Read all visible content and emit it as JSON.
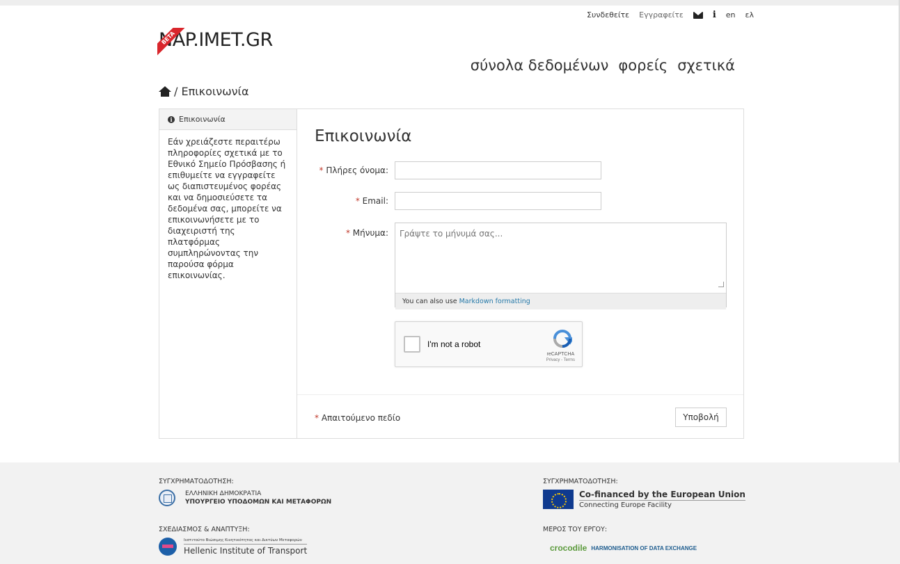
{
  "topbar": {
    "login": "Συνδεθείτε",
    "register": "Εγγραφείτε",
    "envelope_icon": "envelope-icon",
    "info_icon": "info-icon",
    "lang_en": "en",
    "lang_el": "ελ"
  },
  "header": {
    "logo_text": "NAP.IMET.GR",
    "beta": "BETA"
  },
  "nav": {
    "datasets": "σύνολα δεδομένων",
    "organizations": "φορείς",
    "about": "σχετικά"
  },
  "breadcrumb": {
    "home_icon": "home-icon",
    "current": "/ Επικοινωνία"
  },
  "sidebar": {
    "title": "Επικοινωνία",
    "text": "Εάν χρειάζεστε περαιτέρω πληροφορίες σχετικά με το Εθνικό Σημείο Πρόσβασης ή επιθυμείτε να εγγραφείτε ως διαπιστευμένος φορέας και να δημοσιεύσετε τα δεδομένα σας, μπορείτε να επικοινωνήσετε με το διαχειριστή της πλατφόρμας συμπληρώνοντας την παρούσα φόρμα επικοινωνίας."
  },
  "form": {
    "title": "Επικοινωνία",
    "required_mark": "*",
    "fullname_label": "Πλήρες όνομα:",
    "fullname_value": "",
    "email_label": "Email:",
    "email_value": "",
    "message_label": "Μήνυμα:",
    "message_placeholder": "Γράψτε το μήνυμά σας...",
    "markdown_hint": "You can also use",
    "markdown_link": "Markdown formatting",
    "captcha_label": "I'm not a robot",
    "captcha_brand": "reCAPTCHA",
    "captcha_terms": "Privacy - Terms",
    "required_note": "Απαιτούμενο πεδίο",
    "submit": "Υποβολή"
  },
  "footer": {
    "cofund_left_head": "ΣΥΓΧΡΗΜΑΤΟΔΟΤΗΣΗ:",
    "gr_line1": "ΕΛΛΗΝΙΚΗ ΔΗΜΟΚΡΑΤΙΑ",
    "gr_line2": "ΥΠΟΥΡΓΕΙΟ ΥΠΟΔΟΜΩΝ ΚΑΙ ΜΕΤΑΦΟΡΩΝ",
    "design_head": "ΣΧΕΔΙΑΣΜΟΣ & ΑΝΑΠΤΥΞΗ:",
    "hit_small": "Ινστιτούτο Βιώσιμης Κινητικότητας και Δικτύων Μεταφορών",
    "hit_big": "Hellenic Institute of Transport",
    "cofund_right_head": "ΣΥΓΧΡΗΜΑΤΟΔΟΤΗΣΗ:",
    "eu_line1": "Co-financed by the European Union",
    "eu_line2": "Connecting Europe Facility",
    "part_head": "ΜΕΡΟΣ ΤΟΥ ΕΡΓΟΥ:",
    "croc_name": "crocodile",
    "croc_sub": "HARMONISATION OF DATA EXCHANGE"
  }
}
